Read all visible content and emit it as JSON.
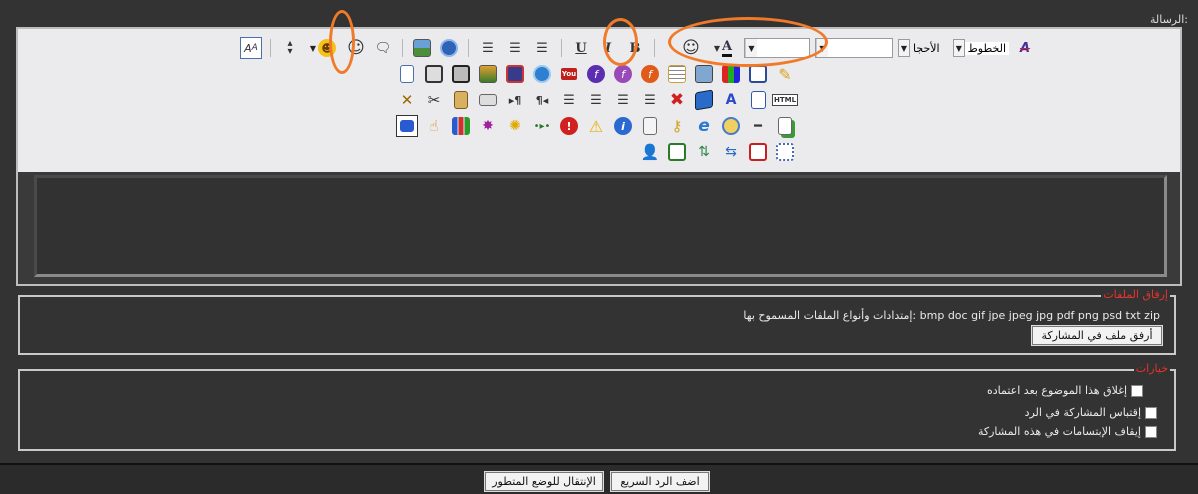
{
  "message_label": "الرسالة:",
  "toolbar": {
    "row1": {
      "font_label": "الخطوط",
      "size_label": "الأحجا",
      "font_value": "",
      "size_value": ""
    }
  },
  "editor": {
    "text_value": ""
  },
  "attachments": {
    "legend": "إرفاق الملفات",
    "allowed_label": "إمتدادات وأنواع الملفات المسموح بها:",
    "extensions": "bmp doc gif jpe jpeg jpg pdf png psd txt zip",
    "attach_button": "أرفق ملف في المشاركة"
  },
  "options": {
    "legend": "خيارات",
    "items": [
      {
        "label": "إغلاق هذا الموضوع بعد اعتماده",
        "checked": false
      },
      {
        "label": "إقتباس المشاركة في الرد",
        "checked": false
      },
      {
        "label": "إيقاف الإبتسامات في هذه المشاركة",
        "checked": false
      }
    ]
  },
  "footer": {
    "quick_reply_button": "اضف الرد السريع",
    "advanced_mode_button": "الإنتقال للوضع المتطور"
  },
  "colors": {
    "panel_bg": "#333333",
    "toolbar_bg": "#ebebed",
    "legend_red": "#e8322c",
    "annotation_orange": "#f07a28"
  }
}
